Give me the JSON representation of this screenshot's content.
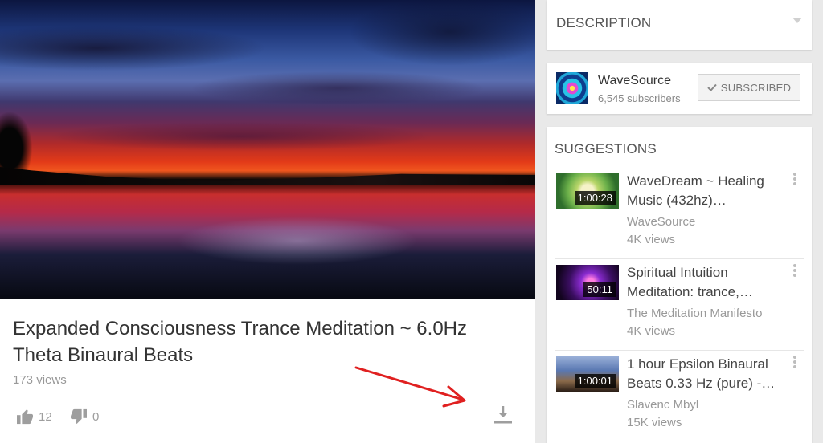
{
  "video": {
    "title": "Expanded Consciousness Trance Meditation ~ 6.0Hz Theta Binaural Beats",
    "views": "173 views",
    "likes": "12",
    "dislikes": "0"
  },
  "description": {
    "heading": "DESCRIPTION"
  },
  "channel": {
    "name": "WaveSource",
    "subscribers": "6,545 subscribers",
    "subscribe_label": "SUBSCRIBED"
  },
  "suggestions": {
    "heading": "SUGGESTIONS",
    "items": [
      {
        "title": "WaveDream ~ Healing Music (432hz)…",
        "channel": "WaveSource",
        "views": "4K views",
        "duration": "1:00:28"
      },
      {
        "title": "Spiritual Intuition Meditation: trance,…",
        "channel": "The Meditation Manifesto",
        "views": "4K views",
        "duration": "50:11"
      },
      {
        "title": "1 hour Epsilon Binaural Beats 0.33 Hz (pure) -…",
        "channel": "Slavenc Mbyl",
        "views": "15K views",
        "duration": "1:00:01"
      }
    ]
  },
  "icons": {
    "like": "thumbs-up-icon",
    "dislike": "thumbs-down-icon",
    "download": "download-icon",
    "menu": "more-vert-icon",
    "expand": "chevron-down-icon",
    "check": "check-icon"
  },
  "colors": {
    "annotation_arrow": "#e02020",
    "icon_gray": "#9e9e9e"
  }
}
